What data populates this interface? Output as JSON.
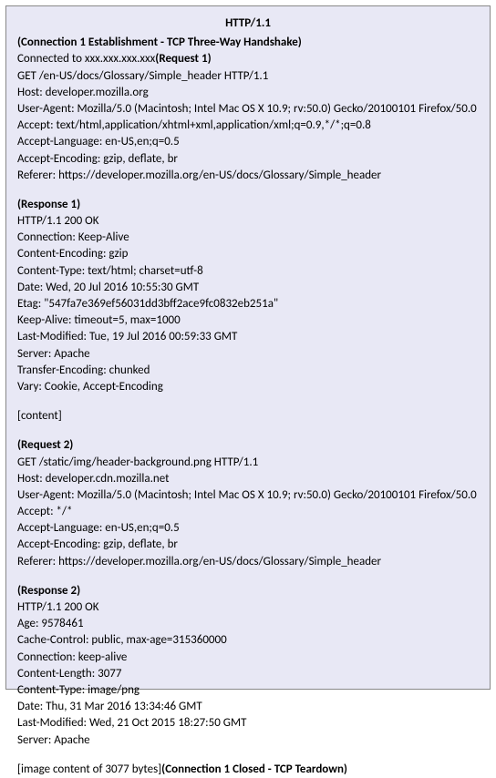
{
  "title": "HTTP/1.1",
  "conn_establish": "(Connection 1 Establishment - TCP Three-Way Handshake)",
  "connected": "Connected to xxx.xxx.xxx.xxx",
  "req1_label": "(Request 1)",
  "req1": {
    "getline": "GET /en-US/docs/Glossary/Simple_header HTTP/1.1",
    "host": "Host: developer.mozilla.org",
    "ua": "User-Agent: Mozilla/5.0 (Macintosh; Intel Mac OS X 10.9; rv:50.0) Gecko/20100101 Firefox/50.0",
    "accept": "Accept: text/html,application/xhtml+xml,application/xml;q=0.9,*/*;q=0.8",
    "acceptlang": "Accept-Language: en-US,en;q=0.5",
    "acceptenc": "Accept-Encoding: gzip, deflate, br",
    "referer": "Referer: https://developer.mozilla.org/en-US/docs/Glossary/Simple_header"
  },
  "resp1_label": "(Response 1)",
  "resp1": {
    "status": "HTTP/1.1 200 OK",
    "connection": "Connection: Keep-Alive",
    "contentenc": "Content-Encoding: gzip",
    "contenttype": "Content-Type: text/html; charset=utf-8",
    "date": "Date: Wed, 20 Jul 2016 10:55:30 GMT",
    "etag": "Etag: \"547fa7e369ef56031dd3bff2ace9fc0832eb251a\"",
    "keepalive": "Keep-Alive: timeout=5, max=1000",
    "lastmod": "Last-Modified: Tue, 19 Jul 2016 00:59:33 GMT",
    "server": "Server: Apache",
    "transferenc": "Transfer-Encoding: chunked",
    "vary": "Vary: Cookie, Accept-Encoding"
  },
  "content_placeholder": "[content]",
  "req2_label": "(Request 2)",
  "req2": {
    "getline": "GET /static/img/header-background.png HTTP/1.1",
    "host": "Host: developer.cdn.mozilla.net",
    "ua": "User-Agent: Mozilla/5.0 (Macintosh; Intel Mac OS X 10.9; rv:50.0) Gecko/20100101 Firefox/50.0",
    "accept": "Accept: */*",
    "acceptlang": "Accept-Language: en-US,en;q=0.5",
    "acceptenc": "Accept-Encoding: gzip, deflate, br",
    "referer": "Referer: https://developer.mozilla.org/en-US/docs/Glossary/Simple_header"
  },
  "resp2_label": "(Response 2)",
  "resp2": {
    "status": "HTTP/1.1 200 OK",
    "age": "Age: 9578461",
    "cachecontrol": "Cache-Control: public, max-age=315360000",
    "connection": "Connection: keep-alive",
    "contentlen": "Content-Length: 3077",
    "contenttype": "Content-Type: image/png",
    "date": "Date: Thu, 31 Mar 2016 13:34:46 GMT",
    "lastmod": "Last-Modified: Wed, 21 Oct 2015 18:27:50 GMT",
    "server": "Server: Apache"
  },
  "image_content": "[image content of 3077 bytes]",
  "conn_closed": "(Connection 1 Closed - TCP Teardown)"
}
